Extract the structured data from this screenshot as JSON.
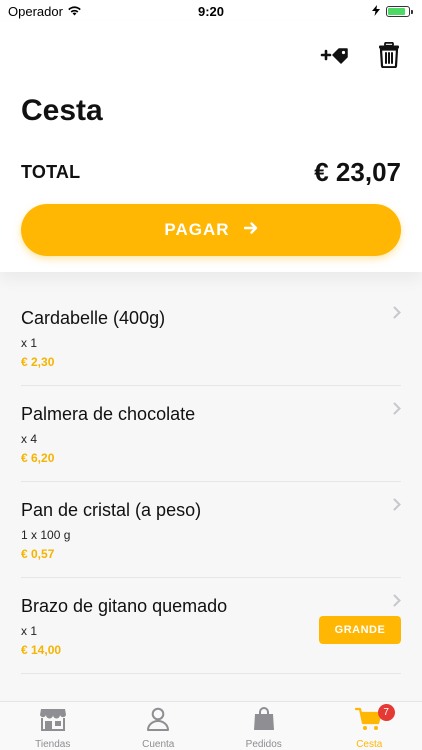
{
  "status_bar": {
    "carrier": "Operador",
    "time": "9:20",
    "battery_level": 0.85
  },
  "header": {
    "title": "Cesta",
    "total_label": "TOTAL",
    "total_value": "€ 23,07",
    "pay_label": "PAGAR",
    "actions": [
      {
        "name": "add-coupon-icon"
      },
      {
        "name": "trash-icon"
      }
    ]
  },
  "items": [
    {
      "name": "Cardabelle (400g)",
      "quantity": "x 1",
      "price": "€ 2,30"
    },
    {
      "name": "Palmera de chocolate",
      "quantity": "x 4",
      "price": "€ 6,20"
    },
    {
      "name": "Pan de cristal (a peso)",
      "quantity": "1 x 100 g",
      "price": "€ 0,57"
    },
    {
      "name": "Brazo de gitano quemado",
      "quantity": "x 1",
      "price": "€ 14,00",
      "size": "GRANDE"
    }
  ],
  "tabs": [
    {
      "label": "Tiendas",
      "icon": "store-icon",
      "active": false
    },
    {
      "label": "Cuenta",
      "icon": "user-icon",
      "active": false
    },
    {
      "label": "Pedidos",
      "icon": "bag-icon",
      "active": false
    },
    {
      "label": "Cesta",
      "icon": "cart-icon",
      "active": true,
      "badge": "7"
    }
  ],
  "colors": {
    "accent": "#ffb703",
    "price": "#f5b400",
    "badge": "#e53935",
    "tab_inactive": "#8e8e93"
  }
}
